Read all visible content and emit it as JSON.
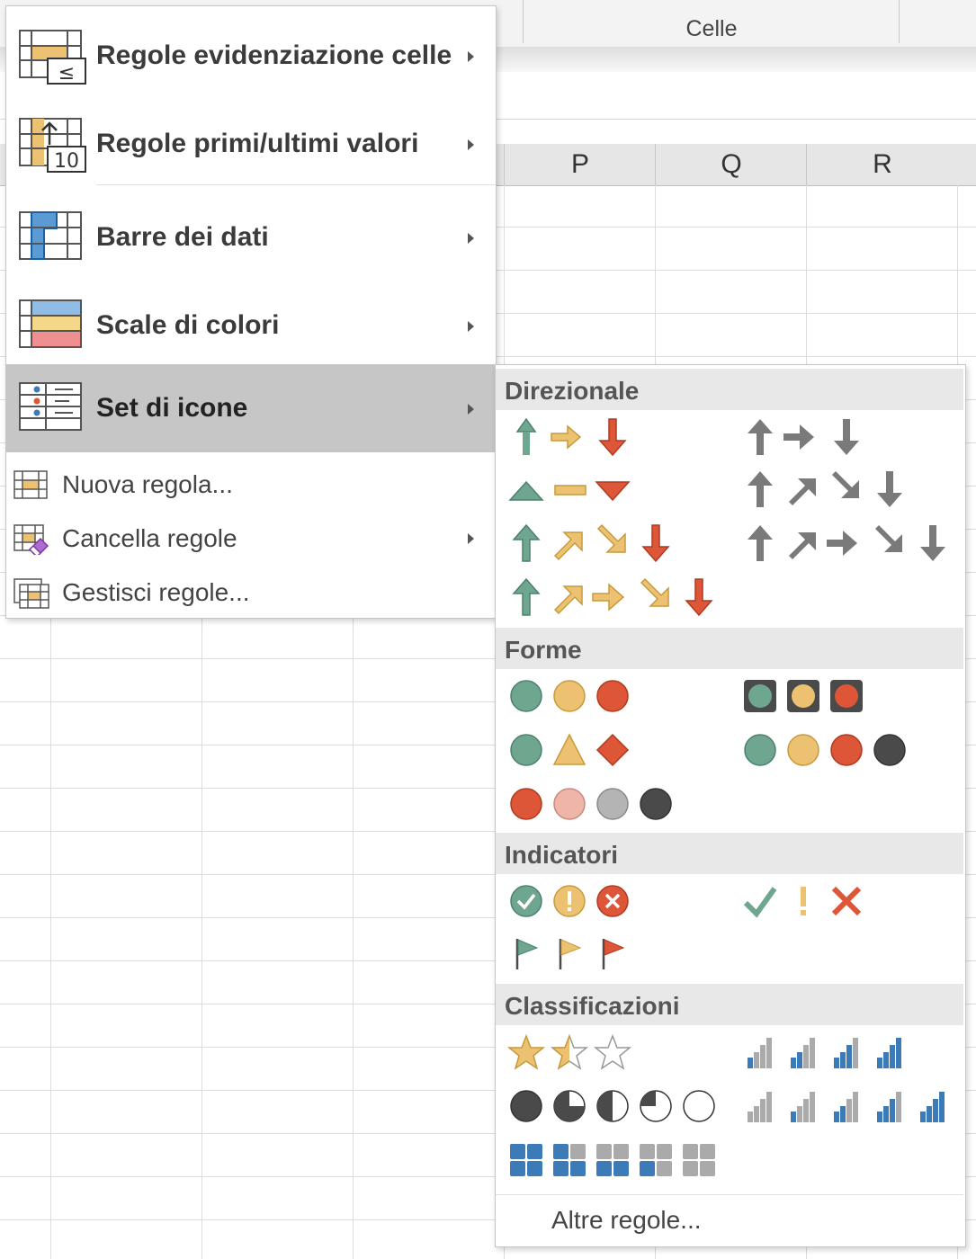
{
  "ribbon": {
    "group_label": "Celle"
  },
  "columns": [
    "P",
    "Q",
    "R"
  ],
  "menu": {
    "items": [
      {
        "label": "Regole evidenziazione celle",
        "icon": "highlight-cells-rules-icon",
        "access_key": "e",
        "has_submenu": true
      },
      {
        "label": "Regole primi/ultimi valori",
        "icon": "top-bottom-rules-icon",
        "access_key": "p",
        "has_submenu": true
      },
      {
        "label": "Barre dei dati",
        "icon": "data-bars-icon",
        "access_key": "B",
        "has_submenu": true
      },
      {
        "label": "Scale di colori",
        "icon": "color-scales-icon",
        "access_key": "a",
        "has_submenu": true
      },
      {
        "label": "Set di icone",
        "icon": "icon-sets-icon",
        "access_key": "S",
        "has_submenu": true,
        "active": true
      }
    ],
    "actions": [
      {
        "label": "Nuova regola...",
        "icon": "new-rule-icon",
        "access_key": "N"
      },
      {
        "label": "Cancella regole",
        "icon": "clear-rules-icon",
        "access_key": "C",
        "has_submenu": true
      },
      {
        "label": "Gestisci regole...",
        "icon": "manage-rules-icon",
        "access_key": "r"
      }
    ]
  },
  "icon_sets": {
    "sections": [
      {
        "title": "Direzionale"
      },
      {
        "title": "Forme"
      },
      {
        "title": "Indicatori"
      },
      {
        "title": "Classificazioni"
      }
    ],
    "more_rules_label": "Altre regole..."
  },
  "colors": {
    "green": "#6fa690",
    "yellow": "#ecc171",
    "red": "#dd5637",
    "gray": "#7a7a7a",
    "dark": "#4a4a4a",
    "blue": "#3d7ab8",
    "pink": "#eeb5a8",
    "lightgray": "#b4b4b4",
    "highlight": "#c6c6c6"
  }
}
